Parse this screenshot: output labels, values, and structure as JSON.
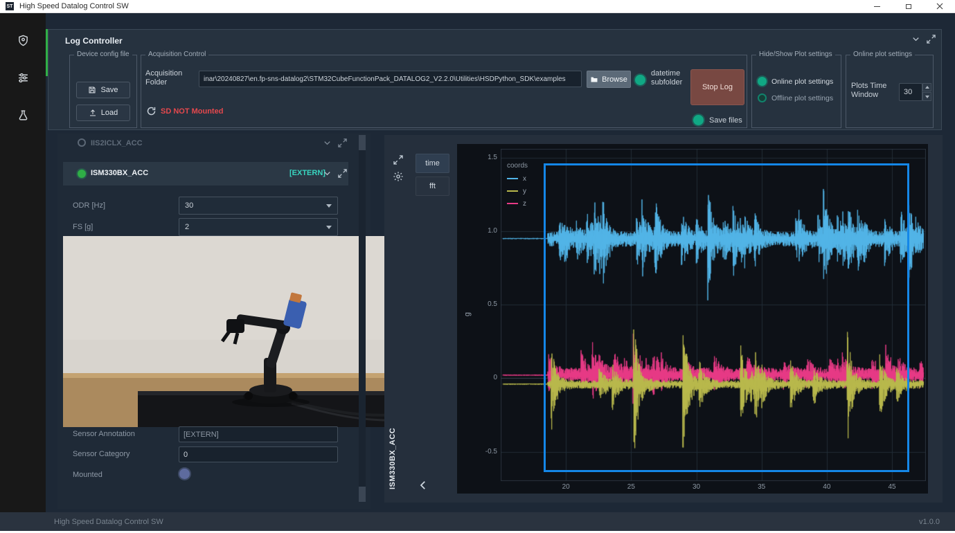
{
  "window": {
    "title": "High Speed Datalog Control SW",
    "logo_text": "ST"
  },
  "colors": {
    "accent_green": "#2fae46",
    "toggle_teal": "#10a884",
    "extern_teal": "#38d5c0",
    "error_red": "#e5484d",
    "selection_blue": "#1487e8"
  },
  "log_controller": {
    "title": "Log Controller",
    "device_config": {
      "title": "Device config file",
      "save": "Save",
      "load": "Load"
    },
    "acquisition": {
      "title": "Acquisition Control",
      "folder_label": "Acquisition Folder",
      "folder_value": "inar\\20240827\\en.fp-sns-datalog2\\STM32CubeFunctionPack_DATALOG2_V2.2.0\\Utilities\\HSDPython_SDK\\examples",
      "browse": "Browse",
      "datetime_subfolder": "datetime subfolder",
      "sd_status": "SD NOT Mounted",
      "stop_log": "Stop Log",
      "save_files": "Save files"
    },
    "hide_show": {
      "title": "Hide/Show Plot settings",
      "online": "Online plot settings",
      "offline": "Offline plot settings"
    },
    "online_settings": {
      "title": "Online plot settings",
      "time_window_label": "Plots Time Window",
      "time_window_value": "30"
    }
  },
  "sensor_list": {
    "inactive_sensor": "IIS2ICLX_ACC",
    "active_sensor": "ISM330BX_ACC",
    "extern_tag": "[EXTERN]",
    "odr_label": "ODR [Hz]",
    "odr_value": "30",
    "fs_label": "FS [g]",
    "fs_value": "2",
    "annotation_label": "Sensor Annotation",
    "annotation_value": "[EXTERN]",
    "category_label": "Sensor Category",
    "category_value": "0",
    "mounted_label": "Mounted"
  },
  "plot_panel": {
    "time_tab": "time",
    "fft_tab": "fft",
    "sensor_label": "ISM330BX_ACC"
  },
  "status_bar": {
    "left": "High Speed Datalog Control SW",
    "version": "v1.0.0"
  },
  "chart_data": {
    "type": "line",
    "legend_title": "coords",
    "ylabel": "g",
    "xlabel": "",
    "xlim": [
      15.0,
      47.6
    ],
    "ylim": [
      -0.7,
      1.56
    ],
    "xticks": [
      {
        "v": 20,
        "label": "20"
      },
      {
        "v": 25,
        "label": "25"
      },
      {
        "v": 30,
        "label": "30"
      },
      {
        "v": 35,
        "label": "35"
      },
      {
        "v": 40,
        "label": "40"
      },
      {
        "v": 45,
        "label": "45"
      }
    ],
    "yticks": [
      {
        "v": 1.5,
        "label": "1.5"
      },
      {
        "v": 1.0,
        "label": "1.0"
      },
      {
        "v": 0.5,
        "label": "0.5"
      },
      {
        "v": 0,
        "label": "0"
      },
      {
        "v": -0.5,
        "label": "-0.5"
      }
    ],
    "grid": true,
    "legend_position": "top-left",
    "signal_start_x": 18.6,
    "series": [
      {
        "name": "x",
        "color": "#52b5e8",
        "baseline": 0.95,
        "noise": 0.05,
        "burst_amp": 0.5,
        "burst_prob": 0.08,
        "up": 0.9,
        "down": 1.05,
        "seed": 11
      },
      {
        "name": "y",
        "color": "#b9b94c",
        "baseline": -0.04,
        "noise": 0.03,
        "burst_amp": 0.65,
        "burst_prob": 0.025,
        "up": 0.8,
        "down": 1.0,
        "seed": 23
      },
      {
        "name": "z",
        "color": "#e83a86",
        "baseline": 0.02,
        "noise": 0.05,
        "burst_amp": 0.32,
        "burst_prob": 0.05,
        "up": 1.0,
        "down": 0.75,
        "seed": 37
      }
    ],
    "selection_box": {
      "x0": 18.3,
      "x1": 46.3,
      "y0": -0.64,
      "y1": 1.46
    }
  }
}
